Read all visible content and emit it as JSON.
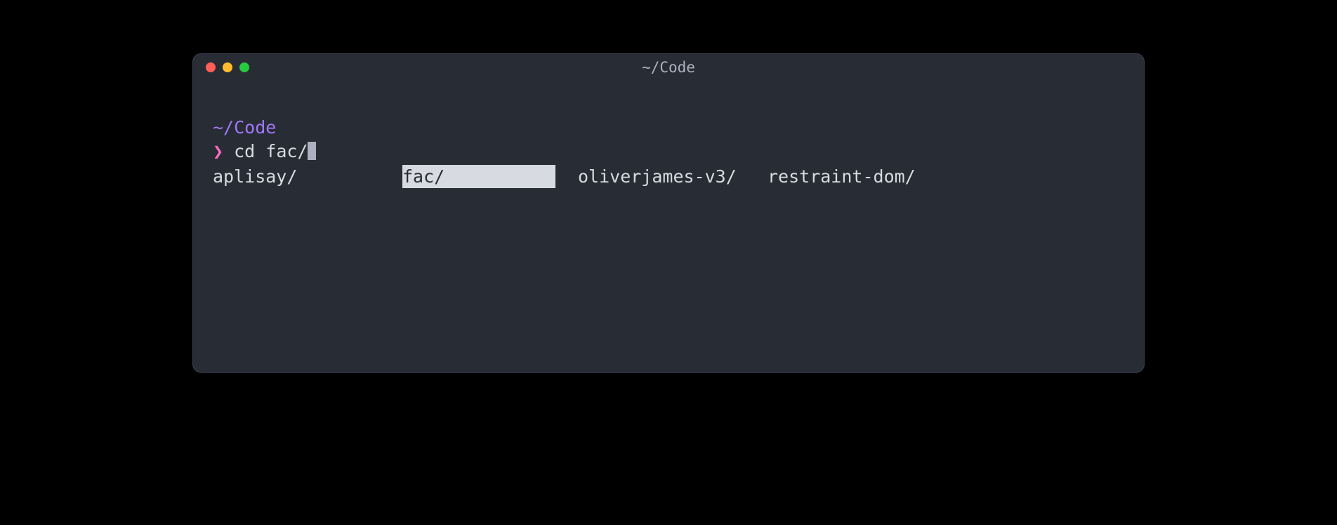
{
  "window": {
    "title": "~/Code"
  },
  "prompt": {
    "path": "~/Code",
    "char": "❯",
    "command": " cd fac/"
  },
  "completions": {
    "items": [
      {
        "label": "aplisay/",
        "selected": false
      },
      {
        "label": "fac/",
        "selected": true
      },
      {
        "label": "oliverjames-v3/",
        "selected": false
      },
      {
        "label": "restraint-dom/",
        "selected": false
      }
    ]
  }
}
